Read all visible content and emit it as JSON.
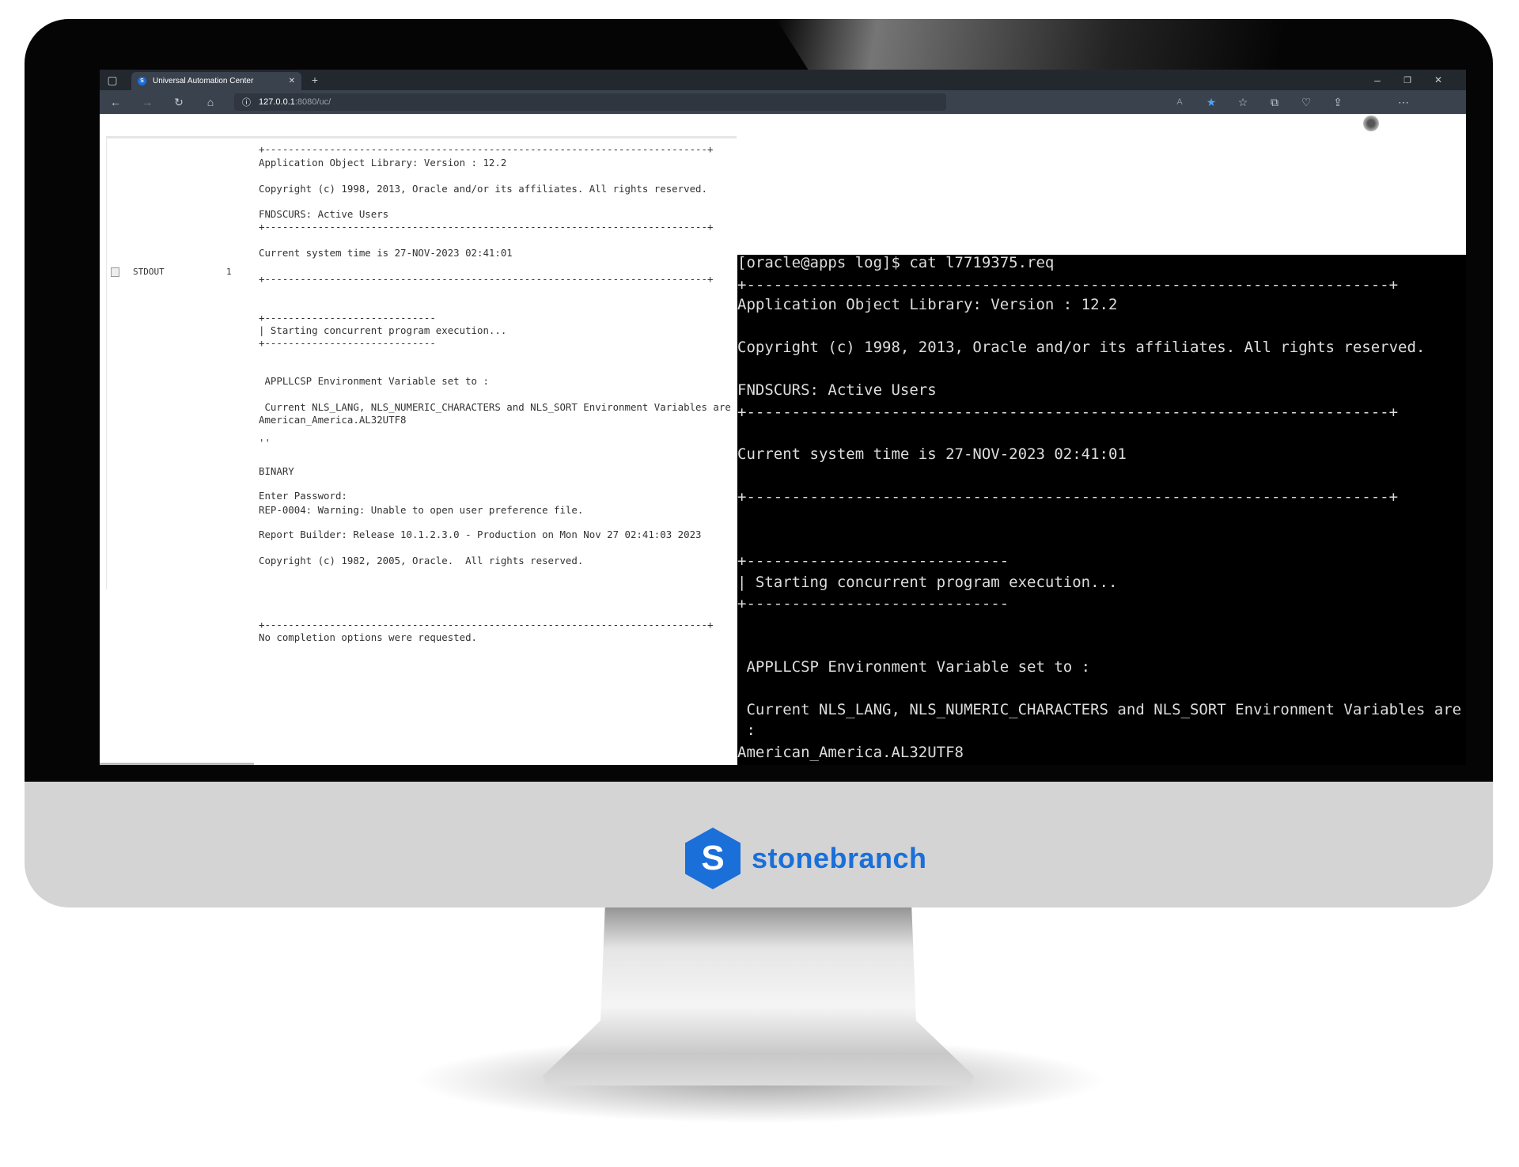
{
  "browser": {
    "tab_title": "Universal Automation Center",
    "tab_favicon": "S",
    "url_host": "127.0.0.1",
    "url_path": ":8080/uc/",
    "window_controls": [
      "minimize-icon",
      "restore-icon",
      "close-icon"
    ],
    "toolbar_icons": [
      "read-aloud-icon",
      "favorite-star-icon",
      "favorites-icon",
      "collections-icon",
      "browser-essentials-icon",
      "share-icon",
      "profile-avatar",
      "more-icon"
    ],
    "accent": "#1a6fd9"
  },
  "output_panel": {
    "row_label": "STDOUT",
    "row_count": "1",
    "lines": [
      "+---------------------------------------------------------------------------+",
      "Application Object Library: Version : 12.2",
      "Copyright (c) 1998, 2013, Oracle and/or its affiliates. All rights reserved.",
      "FNDSCURS: Active Users",
      "+---------------------------------------------------------------------------+",
      "Current system time is 27-NOV-2023 02:41:01",
      "+---------------------------------------------------------------------------+",
      "+-----------------------------",
      "| Starting concurrent program execution...",
      "+-----------------------------",
      " APPLLCSP Environment Variable set to :",
      " Current NLS_LANG, NLS_NUMERIC_CHARACTERS and NLS_SORT Environment Variables are",
      "American_America.AL32UTF8",
      "''",
      "BINARY",
      "Enter Password:",
      "REP-0004: Warning: Unable to open user preference file.",
      "Report Builder: Release 10.1.2.3.0 - Production on Mon Nov 27 02:41:03 2023",
      "Copyright (c) 1982, 2005, Oracle.  All rights reserved.",
      "+---------------------------------------------------------------------------+",
      "No completion options were requested."
    ]
  },
  "terminal": {
    "lines": [
      "[oracle@apps log]$ cat l7719375.req",
      "+-----------------------------------------------------------------------+",
      "Application Object Library: Version : 12.2",
      "Copyright (c) 1998, 2013, Oracle and/or its affiliates. All rights reserved.",
      "FNDSCURS: Active Users",
      "+-----------------------------------------------------------------------+",
      "Current system time is 27-NOV-2023 02:41:01",
      "+-----------------------------------------------------------------------+",
      "+-----------------------------",
      "| Starting concurrent program execution...",
      "+-----------------------------",
      " APPLLCSP Environment Variable set to :",
      " Current NLS_LANG, NLS_NUMERIC_CHARACTERS and NLS_SORT Environment Variables are",
      " :",
      "American_America.AL32UTF8"
    ]
  },
  "brand": {
    "logo_letter": "S",
    "name": "stonebranch",
    "color": "#1a6fd9"
  }
}
